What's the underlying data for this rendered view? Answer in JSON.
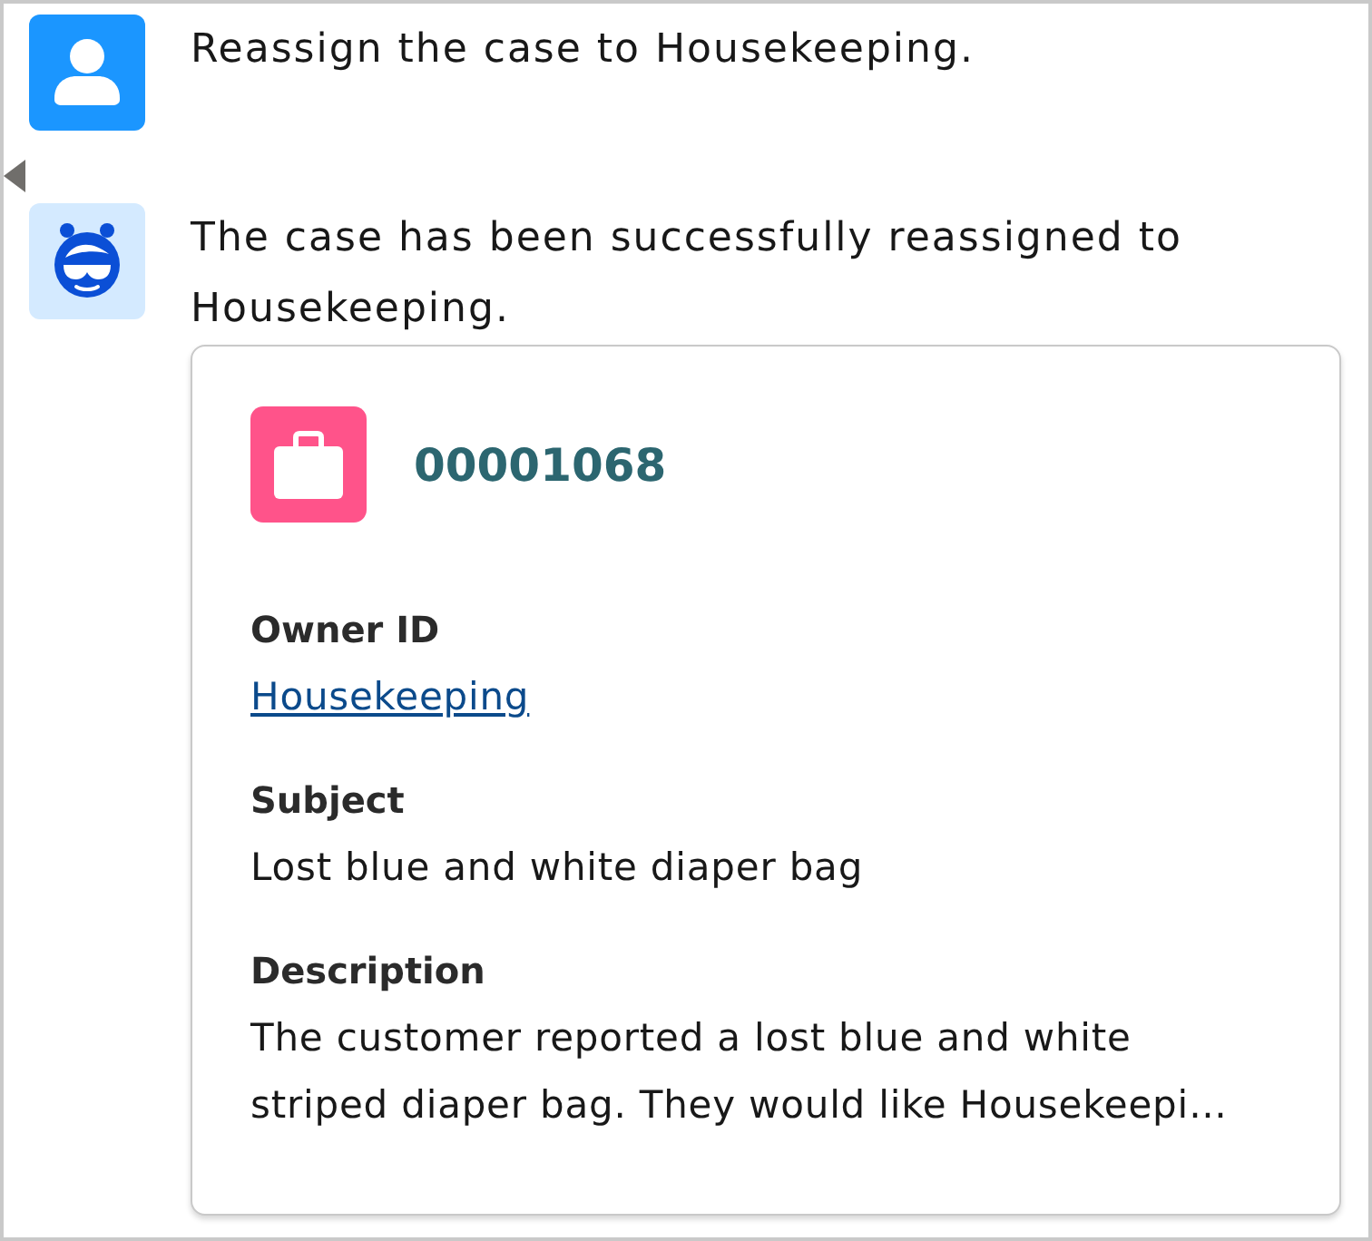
{
  "messages": [
    {
      "kind": "user",
      "text": "Reassign the case to Housekeeping."
    },
    {
      "kind": "bot",
      "text": "The case has been successfully reassigned to Housekeeping.",
      "record": {
        "number": "00001068",
        "fields": [
          {
            "label": "Owner ID",
            "value": "Housekeeping",
            "kind": "link"
          },
          {
            "label": "Subject",
            "value": "Lost blue and white diaper bag",
            "kind": "text"
          },
          {
            "label": "Description",
            "value": "The customer reported a lost blue and white striped diaper bag. They would like Housekeepi…",
            "kind": "text"
          }
        ]
      }
    }
  ]
}
